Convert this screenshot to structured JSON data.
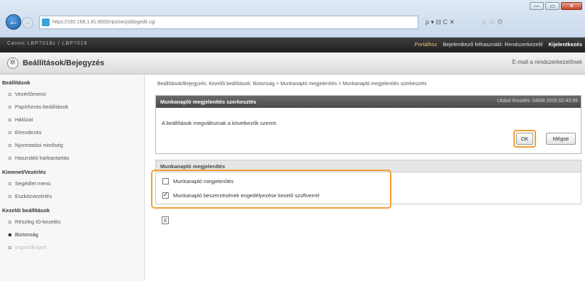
{
  "browser": {
    "url": "https://192.168.1.81:8000/rps/secjoblogedit.cgi",
    "search_glyph": "ρ ▾ ⊟ C ✕",
    "tab_glyphs": "⌂ ☆ ⚙",
    "window_buttons": [
      "—",
      "▭",
      "✕"
    ]
  },
  "topbar": {
    "model": "Canon   LBP7018c / LBP7018",
    "portal": "Portálhoz",
    "user": "Bejelentkező felhasználó: Rendszerkezelő",
    "logout": "Kijelentkezés"
  },
  "titlebar": {
    "title": "Beállítások/Bejegyzés",
    "mail_link": "E-mail a rendszerkezelőnek"
  },
  "sidebar": {
    "groups": [
      {
        "label": "Beállítások",
        "items": [
          "Vezérlőmenü",
          "Papírforrás-beállítások",
          "Hálózat",
          "Elrendezés",
          "Nyomtatási minőség",
          "Használói karbantartás"
        ]
      },
      {
        "label": "Kimenet/Vezérlés",
        "items": [
          "Segédlet menü",
          "Eszközvezérlés"
        ]
      },
      {
        "label": "Kezelői beállítások",
        "items": [
          "Részleg ID-kezelés",
          "Biztonság",
          "Import/Export"
        ]
      }
    ]
  },
  "main": {
    "breadcrumb": "Beállítások/Bejegyzés: Kezelői beállítások: Biztonság > Munkanapló megjelenítés > Munkanapló megjelenítés szerkesztés",
    "panel_title": "Munkanapló megjelenítés szerkesztés",
    "last_update": "Utolsó frissítés: 04/09 2015 02:43:55",
    "message": "A beállítások megváltoznak a következők szerint.",
    "ok_label": "OK",
    "cancel_label": "Mégse",
    "section_title": "Munkanapló megjelenítés",
    "checkboxes": [
      {
        "label": "Munkanapló megjelenítés",
        "checked": false
      },
      {
        "label": "Munkanapló beszerzésének engedélyezése kezelő szoftverrel",
        "checked": true
      }
    ]
  },
  "colors": {
    "highlight": "#f0a030",
    "header_dark": "#2d2d2d",
    "panel_header": "#555555"
  }
}
